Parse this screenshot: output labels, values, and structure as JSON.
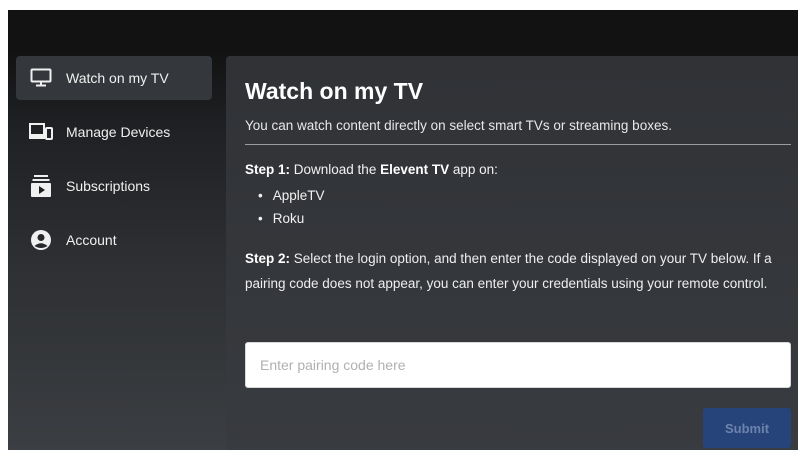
{
  "sidebar": {
    "items": [
      {
        "label": "Watch on my TV",
        "icon": "tv-icon",
        "active": true
      },
      {
        "label": "Manage Devices",
        "icon": "devices-icon",
        "active": false
      },
      {
        "label": "Subscriptions",
        "icon": "subscriptions-icon",
        "active": false
      },
      {
        "label": "Account",
        "icon": "account-icon",
        "active": false
      }
    ]
  },
  "main": {
    "title": "Watch on my TV",
    "subtitle": "You can watch content directly on select smart TVs or streaming boxes.",
    "step1": {
      "label": "Step 1:",
      "text_before": " Download the ",
      "app_name": "Elevent TV",
      "text_after": " app on:",
      "platforms": [
        "AppleTV",
        "Roku"
      ]
    },
    "step2": {
      "label": "Step 2:",
      "text": " Select the login option, and then enter the code displayed on your TV below. If a pairing code does not appear, you can enter your credentials using your remote control."
    },
    "pairing_input": {
      "value": "",
      "placeholder": "Enter pairing code here"
    },
    "submit_label": "Submit"
  },
  "colors": {
    "top_bar": "#121212",
    "panel_bg": "#34373b",
    "submit_bg": "#26447a",
    "submit_text": "#6d83ad"
  }
}
